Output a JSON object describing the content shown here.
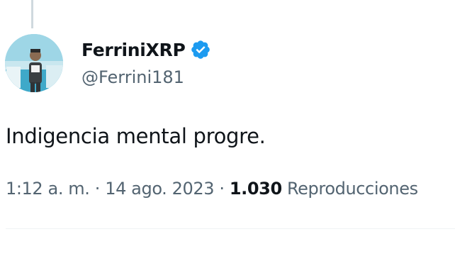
{
  "tweet": {
    "display_name": "FerriniXRP",
    "handle": "@Ferrini181",
    "verified": true,
    "text": "Indigencia mental progre.",
    "time": "1:12 a. m.",
    "separator": "·",
    "date": "14 ago. 2023",
    "views_count": "1.030",
    "views_label": "Reproducciones"
  },
  "icons": {
    "verified": "verified-badge-icon",
    "avatar": "profile-photo"
  },
  "colors": {
    "verified_blue": "#1d9bf0",
    "primary_text": "#0f1419",
    "secondary_text": "#536471",
    "divider": "#eff3f4"
  }
}
